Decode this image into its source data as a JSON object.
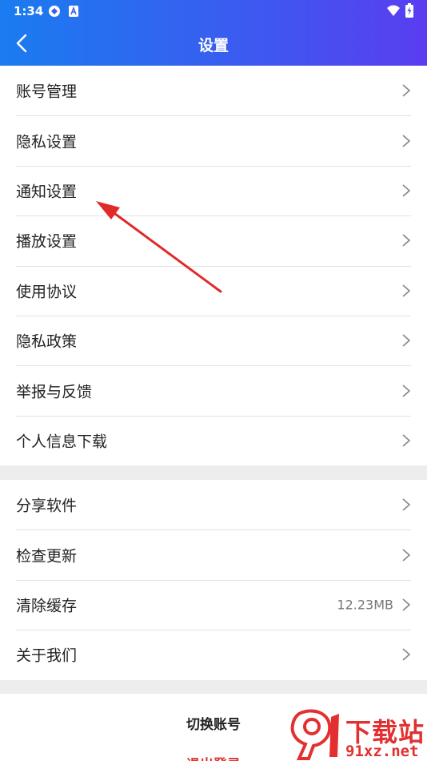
{
  "status_bar": {
    "time": "1:34"
  },
  "nav": {
    "title": "设置"
  },
  "group1": [
    {
      "label": "账号管理"
    },
    {
      "label": "隐私设置"
    },
    {
      "label": "通知设置"
    },
    {
      "label": "播放设置"
    },
    {
      "label": "使用协议"
    },
    {
      "label": "隐私政策"
    },
    {
      "label": "举报与反馈"
    },
    {
      "label": "个人信息下载"
    }
  ],
  "group2": [
    {
      "label": "分享软件",
      "value": ""
    },
    {
      "label": "检查更新",
      "value": ""
    },
    {
      "label": "清除缓存",
      "value": "12.23MB"
    },
    {
      "label": "关于我们",
      "value": ""
    }
  ],
  "actions": {
    "switch_account": "切换账号",
    "logout": "退出登录"
  },
  "watermark": {
    "title": "下载站",
    "url": "91xz.net"
  },
  "colors": {
    "header_start": "#1a7cf0",
    "header_end": "#5a3df0",
    "logout": "#e23030",
    "annotation_arrow": "#e02a2a"
  }
}
